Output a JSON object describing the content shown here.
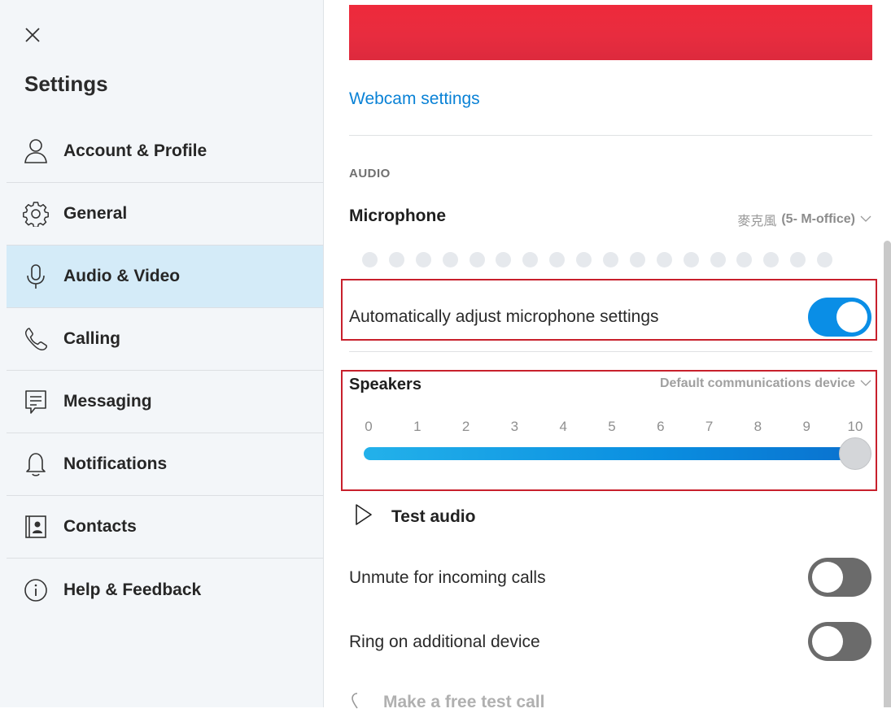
{
  "sidebar": {
    "title": "Settings",
    "items": [
      {
        "label": "Account & Profile",
        "icon": "person-icon",
        "active": false
      },
      {
        "label": "General",
        "icon": "gear-icon",
        "active": false
      },
      {
        "label": "Audio & Video",
        "icon": "microphone-icon",
        "active": true
      },
      {
        "label": "Calling",
        "icon": "phone-icon",
        "active": false
      },
      {
        "label": "Messaging",
        "icon": "message-icon",
        "active": false
      },
      {
        "label": "Notifications",
        "icon": "bell-icon",
        "active": false
      },
      {
        "label": "Contacts",
        "icon": "contacts-icon",
        "active": false
      },
      {
        "label": "Help & Feedback",
        "icon": "info-icon",
        "active": false
      }
    ]
  },
  "main": {
    "webcam_link": "Webcam settings",
    "audio_section": "AUDIO",
    "microphone": {
      "label": "Microphone",
      "device_prefix": "麥克風",
      "device_name": "(5- M-office)",
      "level_dots": 18,
      "level": 0
    },
    "auto_adjust": {
      "label": "Automatically adjust microphone settings",
      "on": true
    },
    "speakers": {
      "label": "Speakers",
      "device": "Default communications device",
      "ticks": [
        "0",
        "1",
        "2",
        "3",
        "4",
        "5",
        "6",
        "7",
        "8",
        "9",
        "10"
      ],
      "volume": 10
    },
    "test_audio": "Test audio",
    "unmute": {
      "label": "Unmute for incoming calls",
      "on": false
    },
    "ring": {
      "label": "Ring on additional device",
      "on": false
    },
    "free_call": "Make a free test call"
  },
  "colors": {
    "accent": "#0a8ee6",
    "link": "#0a82d6",
    "active_nav": "#d4ebf8",
    "highlight_box": "#c8202c"
  }
}
